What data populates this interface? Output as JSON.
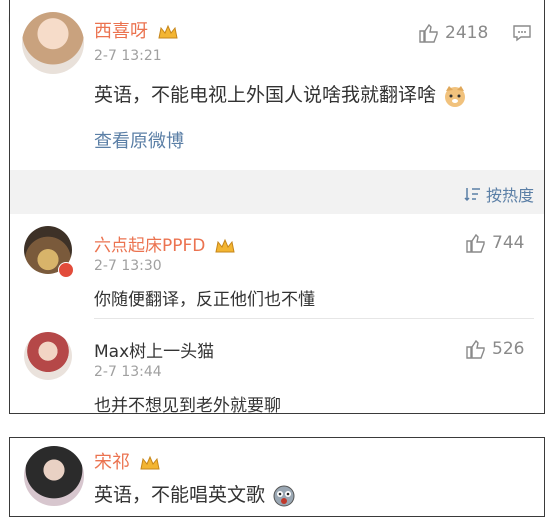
{
  "top_comment": {
    "username": "西喜呀",
    "time": "2-7 13:21",
    "likes": "2418",
    "text": "英语，不能电视上外国人说啥我就翻译啥",
    "view_original": "查看原微博"
  },
  "sort": {
    "label": "按热度"
  },
  "replies": [
    {
      "username": "六点起床PPFD",
      "time": "2-7 13:30",
      "likes": "744",
      "text": "你随便翻译，反正他们也不懂"
    },
    {
      "username": "Max树上一头猫",
      "time": "2-7 13:44",
      "likes": "526",
      "text": "也并不想见到老外就要聊"
    }
  ],
  "bottom_comment": {
    "username": "宋祁",
    "text": "英语，不能唱英文歌"
  },
  "colors": {
    "name": "#eb7350",
    "link": "#5b7fa6",
    "panel_bg": "#f2f2f2"
  }
}
